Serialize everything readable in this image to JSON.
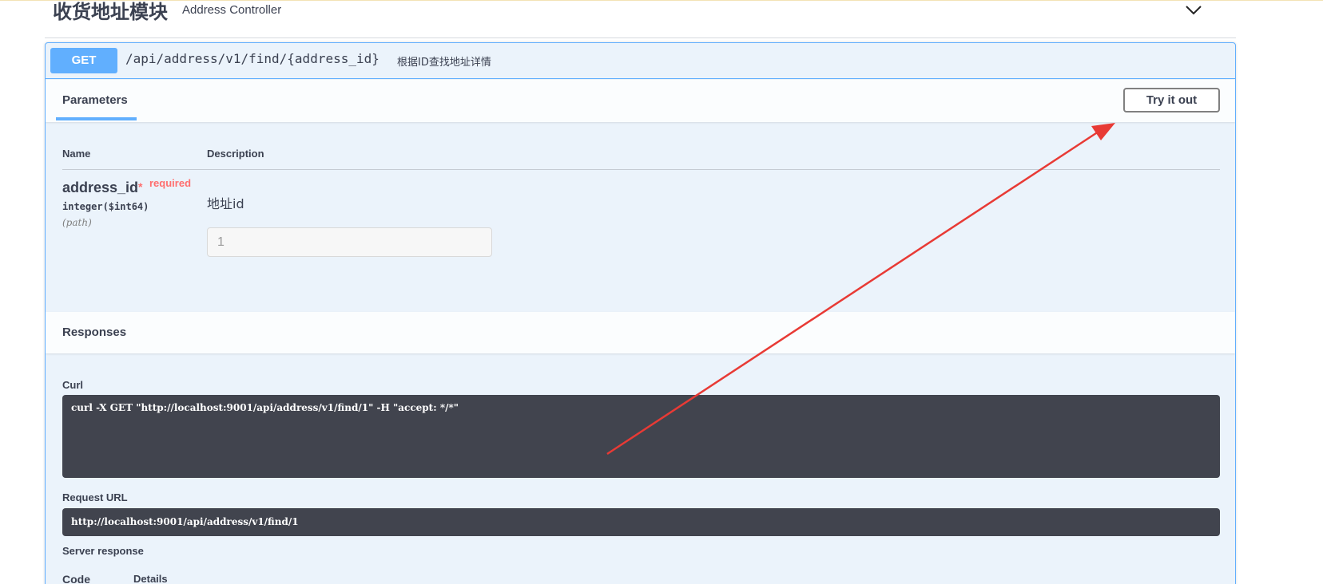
{
  "tag": {
    "title": "收货地址模块",
    "description": "Address Controller",
    "chevron_icon": "chevron-down-icon"
  },
  "operation": {
    "method": "GET",
    "path": "/api/address/v1/find/{address_id}",
    "summary": "根据ID查找地址详情",
    "accent_color": "#61affe"
  },
  "parameters": {
    "tab_label": "Parameters",
    "try_button_label": "Try it out",
    "columns": {
      "name": "Name",
      "description": "Description"
    },
    "items": [
      {
        "name": "address_id",
        "required_star": "*",
        "required_label": "required",
        "type": "integer($int64)",
        "in": "(path)",
        "description": "地址id",
        "placeholder": "1"
      }
    ]
  },
  "responses": {
    "title": "Responses",
    "curl_label": "Curl",
    "curl_command": "curl -X GET \"http://localhost:9001/api/address/v1/find/1\" -H \"accept: */*\"",
    "request_url_label": "Request URL",
    "request_url": "http://localhost:9001/api/address/v1/find/1",
    "server_response_label": "Server response",
    "columns": {
      "code": "Code",
      "details": "Details"
    }
  },
  "annotation": {
    "type": "red-arrow",
    "color": "#e83a35"
  }
}
